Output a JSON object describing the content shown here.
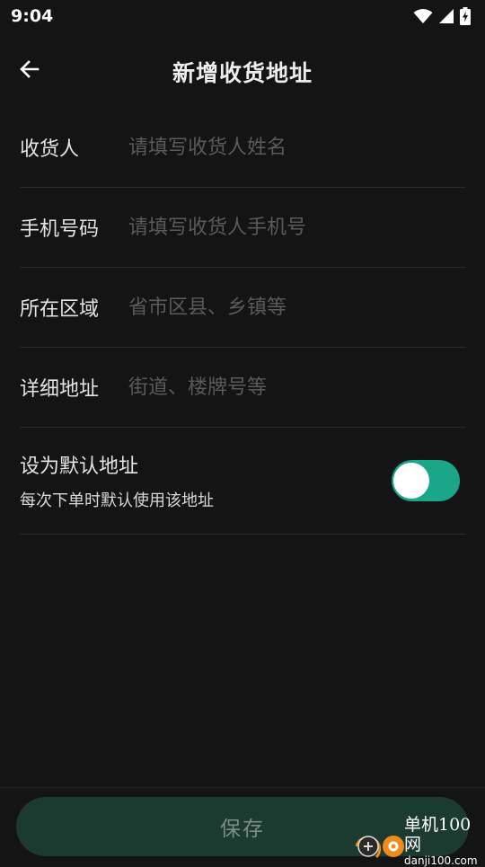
{
  "status_bar": {
    "time": "9:04",
    "icons": [
      "wifi-icon",
      "cellular-signal-icon",
      "battery-charging-icon"
    ]
  },
  "header": {
    "title": "新增收货地址",
    "back_icon": "arrow-left-icon"
  },
  "form": {
    "fields": [
      {
        "label": "收货人",
        "value": "",
        "placeholder": "请填写收货人姓名"
      },
      {
        "label": "手机号码",
        "value": "",
        "placeholder": "请填写收货人手机号"
      },
      {
        "label": "所在区域",
        "value": "",
        "placeholder": "省市区县、乡镇等"
      },
      {
        "label": "详细地址",
        "value": "",
        "placeholder": "街道、楼牌号等"
      }
    ],
    "default_address": {
      "title": "设为默认地址",
      "description": "每次下单时默认使用该地址",
      "enabled": true
    }
  },
  "footer": {
    "save_label": "保存"
  },
  "watermark": {
    "name": "单机100网",
    "domain": "danji100.com"
  },
  "colors": {
    "background": "#141414",
    "accent": "#1aa789",
    "save_button_bg": "#1b3a30",
    "placeholder": "#5a5a5a",
    "divider": "#2c2c2c"
  }
}
